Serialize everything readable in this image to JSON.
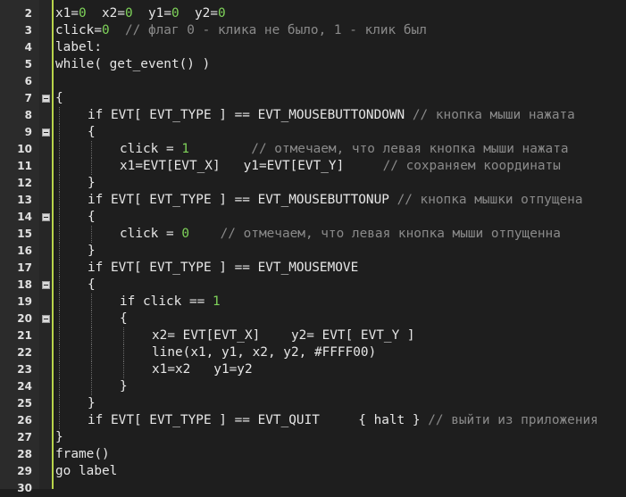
{
  "editor": {
    "lines": [
      {
        "n": "2",
        "code": "x1=0  x2=0  y1=0  y2=0",
        "comment": "",
        "fold": false,
        "indent": 0
      },
      {
        "n": "3",
        "code": "click=0  ",
        "comment": "// флаг 0 - клика не было, 1 - клик был",
        "fold": false,
        "indent": 0
      },
      {
        "n": "4",
        "code": "label:",
        "comment": "",
        "fold": false,
        "indent": 0
      },
      {
        "n": "5",
        "code": "while( get_event() )",
        "comment": "",
        "fold": false,
        "indent": 0
      },
      {
        "n": "6",
        "code": "",
        "comment": "",
        "fold": false,
        "indent": 0
      },
      {
        "n": "7",
        "code": "{",
        "comment": "",
        "fold": true,
        "indent": 0
      },
      {
        "n": "8",
        "code": "if EVT[ EVT_TYPE ] == EVT_MOUSEBUTTONDOWN ",
        "comment": "// кнопка мыши нажата",
        "fold": false,
        "indent": 1
      },
      {
        "n": "9",
        "code": "{",
        "comment": "",
        "fold": true,
        "indent": 1
      },
      {
        "n": "10",
        "code": "click = 1        ",
        "comment": "// отмечаем, что левая кнопка мыши нажата",
        "fold": false,
        "indent": 2
      },
      {
        "n": "11",
        "code": "x1=EVT[EVT_X]   y1=EVT[EVT_Y]     ",
        "comment": "// сохраняем координаты",
        "fold": false,
        "indent": 2
      },
      {
        "n": "12",
        "code": "}",
        "comment": "",
        "fold": false,
        "indent": 1
      },
      {
        "n": "13",
        "code": "if EVT[ EVT_TYPE ] == EVT_MOUSEBUTTONUP ",
        "comment": "// кнопка мышки отпущена",
        "fold": false,
        "indent": 1
      },
      {
        "n": "14",
        "code": "{",
        "comment": "",
        "fold": true,
        "indent": 1
      },
      {
        "n": "15",
        "code": "click = 0    ",
        "comment": "// отмечаем, что левая кнопка мыши отпущенна",
        "fold": false,
        "indent": 2
      },
      {
        "n": "16",
        "code": "}",
        "comment": "",
        "fold": false,
        "indent": 1
      },
      {
        "n": "17",
        "code": "if EVT[ EVT_TYPE ] == EVT_MOUSEMOVE",
        "comment": "",
        "fold": false,
        "indent": 1
      },
      {
        "n": "18",
        "code": "{",
        "comment": "",
        "fold": true,
        "indent": 1
      },
      {
        "n": "19",
        "code": "if click == 1",
        "comment": "",
        "fold": false,
        "indent": 2
      },
      {
        "n": "20",
        "code": "{",
        "comment": "",
        "fold": true,
        "indent": 2
      },
      {
        "n": "21",
        "code": "x2= EVT[EVT_X]    y2= EVT[ EVT_Y ]",
        "comment": "",
        "fold": false,
        "indent": 3
      },
      {
        "n": "22",
        "code": "line(x1, y1, x2, y2, #FFFF00)",
        "comment": "",
        "fold": false,
        "indent": 3
      },
      {
        "n": "23",
        "code": "x1=x2   y1=y2",
        "comment": "",
        "fold": false,
        "indent": 3
      },
      {
        "n": "24",
        "code": "}",
        "comment": "",
        "fold": false,
        "indent": 2
      },
      {
        "n": "25",
        "code": "}",
        "comment": "",
        "fold": false,
        "indent": 1
      },
      {
        "n": "26",
        "code": "if EVT[ EVT_TYPE ] == EVT_QUIT     { halt } ",
        "comment": "// выйти из приложения",
        "fold": false,
        "indent": 1
      },
      {
        "n": "27",
        "code": "}",
        "comment": "",
        "fold": false,
        "indent": 0
      },
      {
        "n": "28",
        "code": "frame()",
        "comment": "",
        "fold": false,
        "indent": 0
      },
      {
        "n": "29",
        "code": "go label",
        "comment": "",
        "fold": false,
        "indent": 0
      },
      {
        "n": "30",
        "code": "",
        "comment": "",
        "fold": false,
        "indent": 0
      }
    ],
    "colors": {
      "background": "#1e1e1e",
      "gutter": "#2b2b2b",
      "accent": "#b8d44a",
      "number": "#7fd35a",
      "comment": "#8a8a8a",
      "text": "#e6e6e6"
    },
    "fold_icon": "collapse-minus-icon"
  }
}
